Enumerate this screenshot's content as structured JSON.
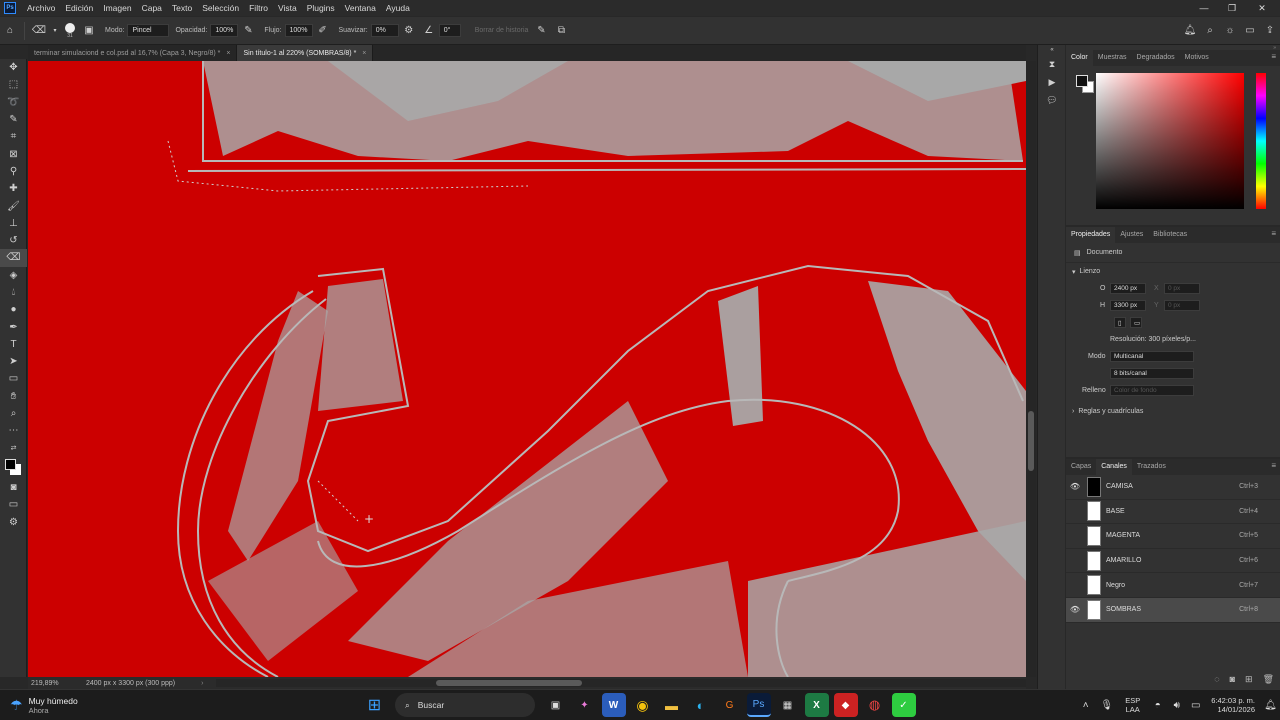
{
  "app": {
    "logo": "Ps",
    "menus": [
      "Archivo",
      "Edición",
      "Imagen",
      "Capa",
      "Texto",
      "Selección",
      "Filtro",
      "Vista",
      "Plugins",
      "Ventana",
      "Ayuda"
    ]
  },
  "options": {
    "brush_size": "31",
    "mode_label": "Modo:",
    "mode_value": "Pincel",
    "opacity_label": "Opacidad:",
    "opacity_value": "100%",
    "flow_label": "Flujo:",
    "flow_value": "100%",
    "smooth_label": "Suavizar:",
    "smooth_value": "0%",
    "angle_value": "0°",
    "history_label": "Borrar de historia"
  },
  "tabs": [
    {
      "label": "terminar simulaciond e col.psd al 16,7% (Capa 3, Negro/8) *",
      "active": false
    },
    {
      "label": "Sin título-1 al 220% (SOMBRAS/8) *",
      "active": true
    }
  ],
  "status": {
    "zoom": "219,89%",
    "doc_size": "2400 px x 3300 px (300 ppp)"
  },
  "color_panel": {
    "tabs": [
      "Color",
      "Muestras",
      "Degradados",
      "Motivos"
    ],
    "active": "Color"
  },
  "properties_panel": {
    "tabs": [
      "Propiedades",
      "Ajustes",
      "Bibliotecas"
    ],
    "doc_label": "Documento",
    "section_canvas": "Lienzo",
    "width_label": "O",
    "width": "2400 px",
    "x_label": "X",
    "x_value": "0 px",
    "height_label": "H",
    "height": "3300 px",
    "y_label": "Y",
    "y_value": "0 px",
    "resolution": "Resolución: 300 píxeles/p...",
    "mode_label": "Modo",
    "mode_value": "Multicanal",
    "depth_value": "8 bits/canal",
    "fill_label": "Relleno",
    "fill_value": "Color de fondo",
    "rulers": "Reglas y cuadrículas"
  },
  "channels_panel": {
    "tabs": [
      "Capas",
      "Canales",
      "Trazados"
    ],
    "active": "Canales",
    "channels": [
      {
        "name": "CAMISA",
        "shortcut": "Ctrl+3",
        "visible": true,
        "selected": false
      },
      {
        "name": "BASE",
        "shortcut": "Ctrl+4",
        "visible": false,
        "selected": false
      },
      {
        "name": "MAGENTA",
        "shortcut": "Ctrl+5",
        "visible": false,
        "selected": false
      },
      {
        "name": "AMARILLO",
        "shortcut": "Ctrl+6",
        "visible": false,
        "selected": false
      },
      {
        "name": "Negro",
        "shortcut": "Ctrl+7",
        "visible": false,
        "selected": false
      },
      {
        "name": "SOMBRAS",
        "shortcut": "Ctrl+8",
        "visible": true,
        "selected": true
      }
    ]
  },
  "taskbar": {
    "weather_title": "Muy húmedo",
    "weather_sub": "Ahora",
    "search": "Buscar",
    "lang1": "ESP",
    "lang2": "LAA",
    "time": "6:42:03 p. m.",
    "date": "14/01/2026"
  },
  "colors": {
    "canvas": "#cc0000",
    "art": "#a8a8a8"
  }
}
